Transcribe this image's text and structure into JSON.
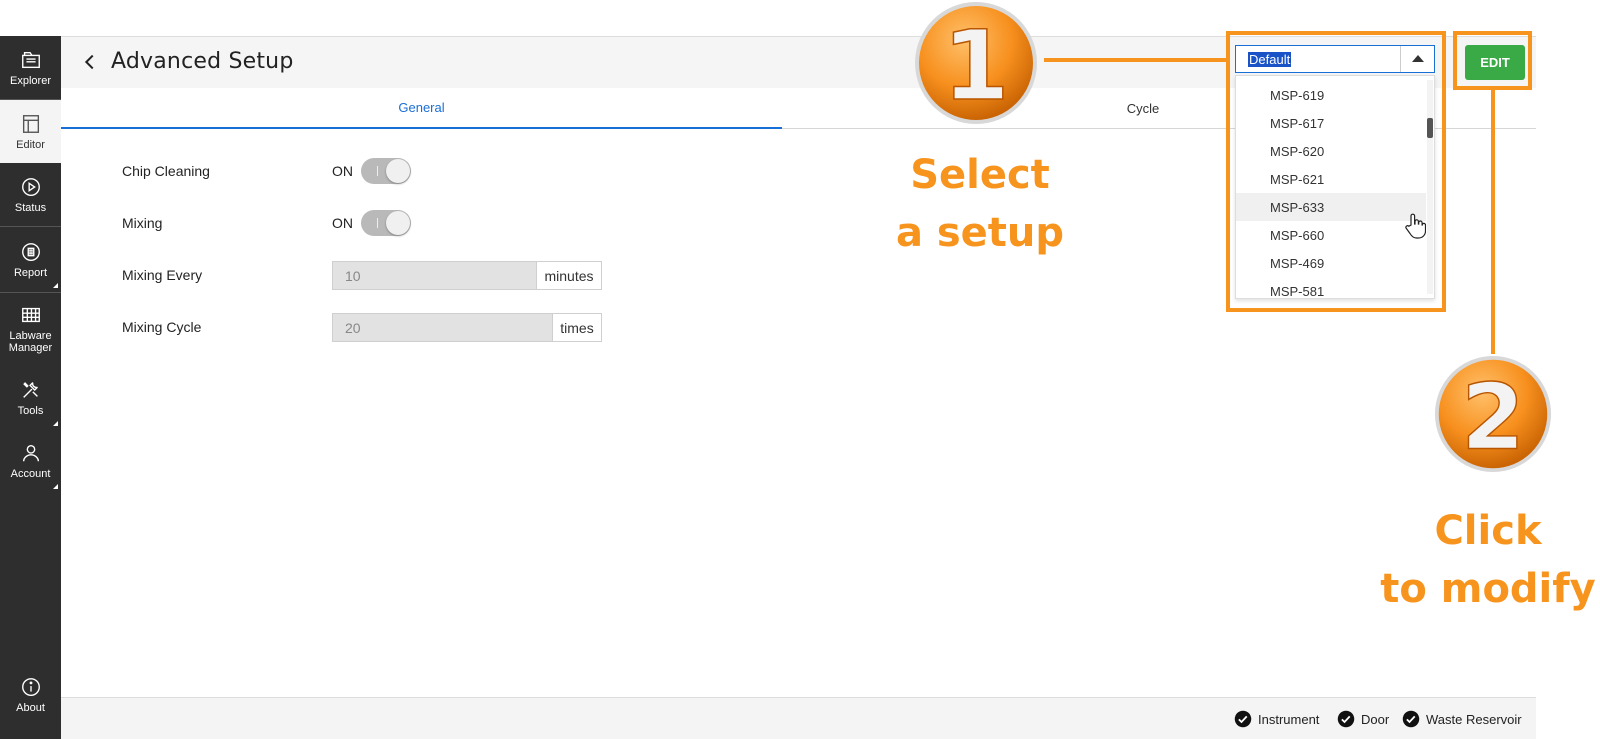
{
  "sidebar": {
    "items": [
      {
        "label": "Explorer",
        "icon": "explorer-icon"
      },
      {
        "label": "Editor",
        "icon": "editor-icon",
        "active": true
      },
      {
        "label": "Status",
        "icon": "play-circle-icon"
      },
      {
        "label": "Report",
        "icon": "clipboard-icon"
      },
      {
        "label_line1": "Labware",
        "label_line2": "Manager",
        "icon": "grid-icon"
      },
      {
        "label": "Tools",
        "icon": "tools-icon"
      },
      {
        "label": "Account",
        "icon": "user-icon"
      },
      {
        "label": "About",
        "icon": "info-icon"
      }
    ]
  },
  "header": {
    "title": "Advanced Setup"
  },
  "tabs": [
    {
      "label": "General",
      "active": true
    },
    {
      "label": "Cycle",
      "active": false
    }
  ],
  "settings": {
    "chip_cleaning": {
      "label": "Chip Cleaning",
      "state": "ON"
    },
    "mixing": {
      "label": "Mixing",
      "state": "ON"
    },
    "mixing_every": {
      "label": "Mixing Every",
      "value": "10",
      "unit": "minutes"
    },
    "mixing_cycle": {
      "label": "Mixing Cycle",
      "value": "20",
      "unit": "times"
    }
  },
  "setup_dropdown": {
    "selected": "Default",
    "options": [
      "MSP-619",
      "MSP-617",
      "MSP-620",
      "MSP-621",
      "MSP-633",
      "MSP-660",
      "MSP-469",
      "MSP-581"
    ],
    "hovered": "MSP-633"
  },
  "edit_button": {
    "label": "EDIT"
  },
  "annotations": {
    "step1": {
      "number": "1",
      "line1": "Select",
      "line2": "a setup"
    },
    "step2": {
      "number": "2",
      "line1": "Click",
      "line2": "to modify"
    }
  },
  "footer": {
    "statuses": [
      "Instrument",
      "Door",
      "Waste Reservoir"
    ]
  },
  "colors": {
    "accent": "#1a6fd6",
    "annotation": "#f7941d",
    "edit": "#3aaa46",
    "sidebar": "#2e2e2e"
  }
}
